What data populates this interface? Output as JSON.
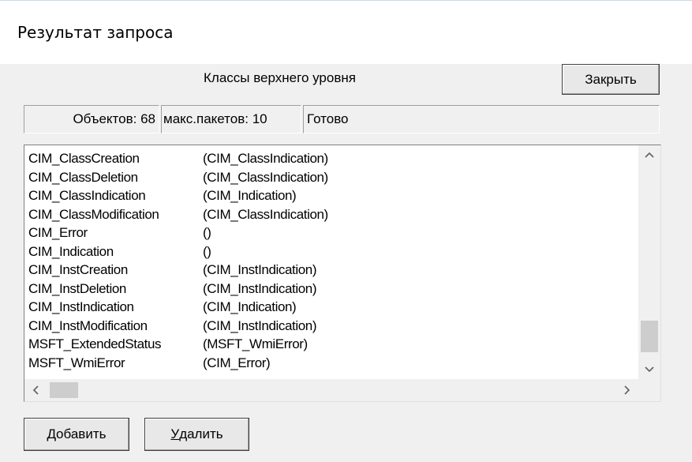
{
  "window": {
    "title": "Результат запроса"
  },
  "dialog": {
    "caption": "Классы верхнего уровня"
  },
  "buttons": {
    "close_label": "Закрыть",
    "add_label_first": "Д",
    "add_label_rest": "обавить",
    "delete_label_first": "У",
    "delete_label_rest": "далить"
  },
  "status": {
    "objects": "Объектов: 68",
    "packets": "макс.пакетов: 10",
    "state": "Готово"
  },
  "classes": [
    {
      "name": "CIM_ClassCreation",
      "parent": "(CIM_ClassIndication)"
    },
    {
      "name": "CIM_ClassDeletion",
      "parent": "(CIM_ClassIndication)"
    },
    {
      "name": "CIM_ClassIndication",
      "parent": "(CIM_Indication)"
    },
    {
      "name": "CIM_ClassModification",
      "parent": "(CIM_ClassIndication)"
    },
    {
      "name": "CIM_Error",
      "parent": "()"
    },
    {
      "name": "CIM_Indication",
      "parent": "()"
    },
    {
      "name": "CIM_InstCreation",
      "parent": "(CIM_InstIndication)"
    },
    {
      "name": "CIM_InstDeletion",
      "parent": "(CIM_InstIndication)"
    },
    {
      "name": "CIM_InstIndication",
      "parent": "(CIM_Indication)"
    },
    {
      "name": "CIM_InstModification",
      "parent": "(CIM_InstIndication)"
    },
    {
      "name": "MSFT_ExtendedStatus",
      "parent": "(MSFT_WmiError)"
    },
    {
      "name": "MSFT_WmiError",
      "parent": "(CIM_Error)"
    }
  ],
  "icons": {
    "scroll_up": "chevron-up-icon",
    "scroll_down": "chevron-down-icon",
    "scroll_left": "chevron-left-icon",
    "scroll_right": "chevron-right-icon"
  }
}
